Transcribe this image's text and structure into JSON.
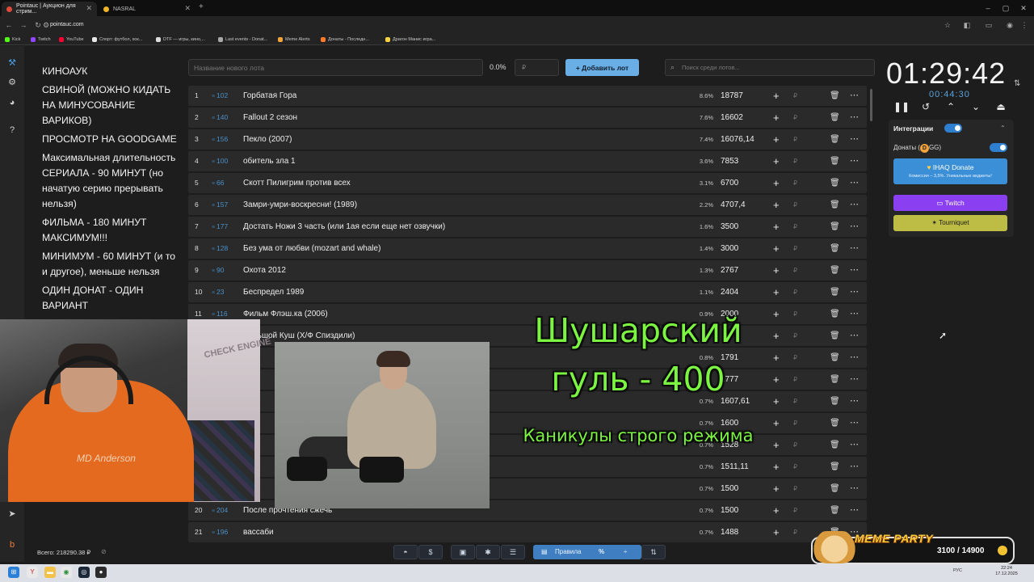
{
  "browser": {
    "tabs": [
      {
        "label": "Pointauc | Аукцион для стрим...",
        "active": true
      },
      {
        "label": "NASRAL",
        "active": false
      }
    ],
    "url": "pointauc.com",
    "bookmarks": [
      "Kick",
      "Twitch",
      "YouTube",
      "Спорт: футбол, хок...",
      "DTF — игры, кино,...",
      "Last events - Donat...",
      "Meme Alerts",
      "Донаты - Последн...",
      "Драгон Манис игра..."
    ]
  },
  "rules": {
    "lines": [
      "КИНОАУК",
      "СВИНОЙ (МОЖНО КИДАТЬ НА МИНУСОВАНИЕ ВАРИКОВ)",
      "ПРОСМОТР НА GOODGAME",
      "Максимальная длительность СЕРИАЛА - 90 МИНУТ (но начатую серию прерывать нельзя)",
      "ФИЛЬМА - 180 МИНУТ МАКСИМУМ!!!",
      "МИНИМУМ - 60 МИНУТ (и то и другое), меньше нельзя",
      "ОДИН ДОНАТ - ОДИН ВАРИАНТ"
    ]
  },
  "controls": {
    "new_lot_placeholder": "Название нового лота",
    "percent": "0.0%",
    "amount_placeholder": "₽",
    "add_button": "Добавить лот",
    "search_placeholder": "Поиск среди лотов..."
  },
  "lots": [
    {
      "idx": "1",
      "id": "102",
      "name": "Горбатая Гора",
      "pct": "8.6%",
      "amount": "18787"
    },
    {
      "idx": "2",
      "id": "140",
      "name": "Fallout 2 сезон",
      "pct": "7.6%",
      "amount": "16602"
    },
    {
      "idx": "3",
      "id": "156",
      "name": "Пекло (2007)",
      "pct": "7.4%",
      "amount": "16076,14"
    },
    {
      "idx": "4",
      "id": "100",
      "name": "обитель зла 1",
      "pct": "3.6%",
      "amount": "7853"
    },
    {
      "idx": "5",
      "id": "66",
      "name": "Скотт Пилигрим против всех",
      "pct": "3.1%",
      "amount": "6700"
    },
    {
      "idx": "6",
      "id": "157",
      "name": "Замри-умри-воскресни! (1989)",
      "pct": "2.2%",
      "amount": "4707,4"
    },
    {
      "idx": "7",
      "id": "177",
      "name": "Достать Ножи 3 часть (или 1ая если еще нет озвучки)",
      "pct": "1.6%",
      "amount": "3500"
    },
    {
      "idx": "8",
      "id": "128",
      "name": "Без ума от любви (mozart and whale)",
      "pct": "1.4%",
      "amount": "3000"
    },
    {
      "idx": "9",
      "id": "90",
      "name": "Охота 2012",
      "pct": "1.3%",
      "amount": "2767"
    },
    {
      "idx": "10",
      "id": "23",
      "name": "Беспредел 1989",
      "pct": "1.1%",
      "amount": "2404"
    },
    {
      "idx": "11",
      "id": "116",
      "name": "Фильм Флэш.ка (2006)",
      "pct": "0.9%",
      "amount": "2000"
    },
    {
      "idx": "",
      "id": "",
      "name": "Большой Куш (Х/Ф Спиздили)",
      "pct": "",
      "amount": ""
    },
    {
      "idx": "",
      "id": "",
      "name": "",
      "pct": "0.8%",
      "amount": "1791"
    },
    {
      "idx": "",
      "id": "",
      "name": "",
      "pct": "",
      "amount": "1777"
    },
    {
      "idx": "",
      "id": "",
      "name": "",
      "pct": "0.7%",
      "amount": "1607,61"
    },
    {
      "idx": "",
      "id": "",
      "name": "",
      "pct": "0.7%",
      "amount": "1600"
    },
    {
      "idx": "",
      "id": "",
      "name": "",
      "pct": "0.7%",
      "amount": "1528"
    },
    {
      "idx": "",
      "id": "",
      "name": "",
      "pct": "0.7%",
      "amount": "1511,11"
    },
    {
      "idx": "",
      "id": "",
      "name": "",
      "pct": "0.7%",
      "amount": "1500"
    },
    {
      "idx": "20",
      "id": "204",
      "name": "После прочтения сжечь",
      "pct": "0.7%",
      "amount": "1500"
    },
    {
      "idx": "21",
      "id": "196",
      "name": "вассаби",
      "pct": "0.7%",
      "amount": "1488"
    }
  ],
  "row_currency": "₽",
  "total": "Всего: 218290.38 ₽",
  "bottom_toolbar": {
    "rules_label": "Правила"
  },
  "timer": {
    "main": "01:29:42",
    "sub": "00:44:30"
  },
  "integrations": {
    "title": "Интеграции",
    "donations_label": "Донаты (",
    "donations_suffix": "GG)",
    "donate_title": "IHAQ Donate",
    "donate_sub": "Комиссия – 3,5%. Уникальные виджеты!",
    "twitch": "Twitch",
    "tourniquet": "Tourniquet"
  },
  "overlay": {
    "title": "Шушарский",
    "cost": "гуль - 400",
    "subtitle": "Каникулы строго режима",
    "webcam_text": "MD Anderson",
    "webcam_sign": "CHECK ENGINE"
  },
  "meme_party": {
    "title": "MEME PARTY",
    "count": "3100 / 14900"
  },
  "taskbar": {
    "tray": "РУС",
    "time": "22:24",
    "date": "17.12.2025"
  }
}
